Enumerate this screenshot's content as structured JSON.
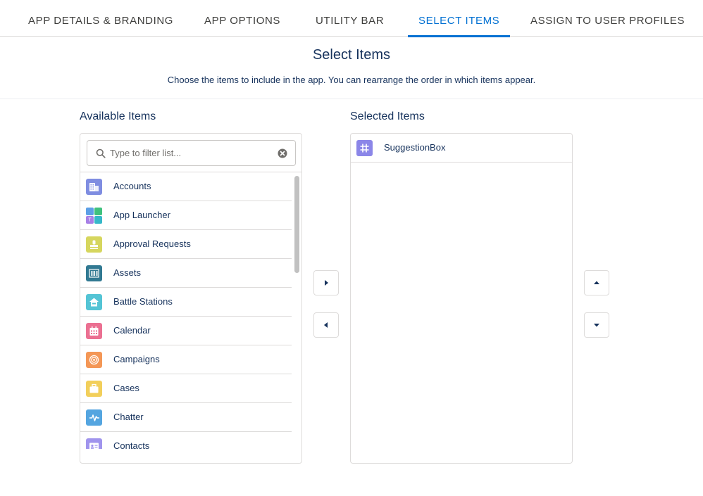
{
  "tabs": [
    {
      "label": "APP DETAILS & BRANDING"
    },
    {
      "label": "APP OPTIONS"
    },
    {
      "label": "UTILITY BAR"
    },
    {
      "label": "SELECT ITEMS"
    },
    {
      "label": "ASSIGN TO USER PROFILES"
    }
  ],
  "active_tab": "SELECT ITEMS",
  "page": {
    "title": "Select Items",
    "description": "Choose the items to include in the app. You can rearrange the order in which items appear."
  },
  "available": {
    "label": "Available Items",
    "search_placeholder": "Type to filter list...",
    "search_value": "",
    "items": [
      {
        "label": "Accounts",
        "icon": "building-icon",
        "color": "#7f8de1"
      },
      {
        "label": "App Launcher",
        "icon": "app-grid-icon",
        "color": "#8b9ae3"
      },
      {
        "label": "Approval Requests",
        "icon": "stamp-icon",
        "color": "#d6d65e"
      },
      {
        "label": "Assets",
        "icon": "barcode-icon",
        "color": "#317992"
      },
      {
        "label": "Battle Stations",
        "icon": "house-icon",
        "color": "#54c4d5"
      },
      {
        "label": "Calendar",
        "icon": "calendar-icon",
        "color": "#eb7092"
      },
      {
        "label": "Campaigns",
        "icon": "target-icon",
        "color": "#f49756"
      },
      {
        "label": "Cases",
        "icon": "briefcase-icon",
        "color": "#f2cf5b"
      },
      {
        "label": "Chatter",
        "icon": "pulse-icon",
        "color": "#54a5e0"
      },
      {
        "label": "Contacts",
        "icon": "contact-card-icon",
        "color": "#a094ed"
      }
    ]
  },
  "selected": {
    "label": "Selected Items",
    "items": [
      {
        "label": "SuggestionBox",
        "icon": "hashtag-icon",
        "color": "#8b86e8"
      }
    ]
  },
  "colors": {
    "accent": "#0070d2",
    "text": "#16325c",
    "border": "#dddbda"
  }
}
